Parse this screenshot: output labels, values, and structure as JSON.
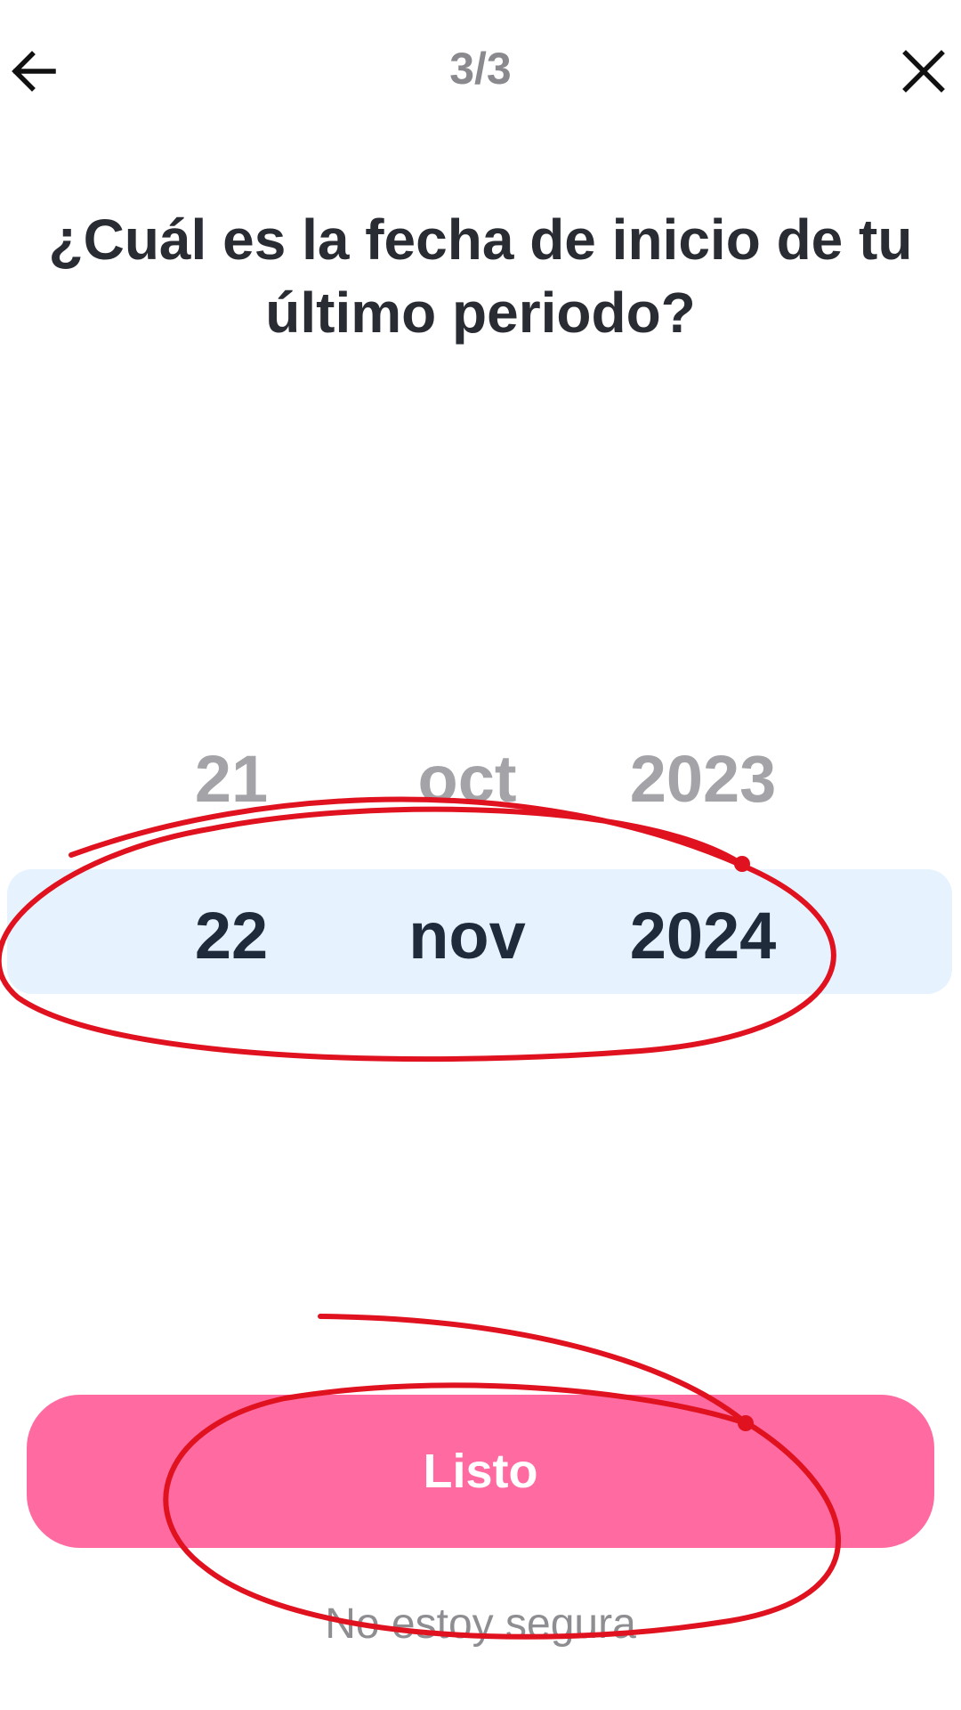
{
  "header": {
    "step_text": "3/3",
    "back_icon": "arrow-left-icon",
    "close_icon": "close-icon"
  },
  "question": {
    "title": "¿Cuál es la fecha de inicio de tu último periodo?"
  },
  "date_picker": {
    "day": {
      "previous": "21",
      "selected": "22"
    },
    "month": {
      "previous": "oct",
      "selected": "nov"
    },
    "year": {
      "previous": "2023",
      "selected": "2024"
    },
    "highlight_color": "#e6f2fd"
  },
  "actions": {
    "done_label": "Listo",
    "done_color": "#ff6aa1",
    "unsure_label": "No estoy segura"
  },
  "annotation": {
    "stroke_color": "#e0121f"
  }
}
